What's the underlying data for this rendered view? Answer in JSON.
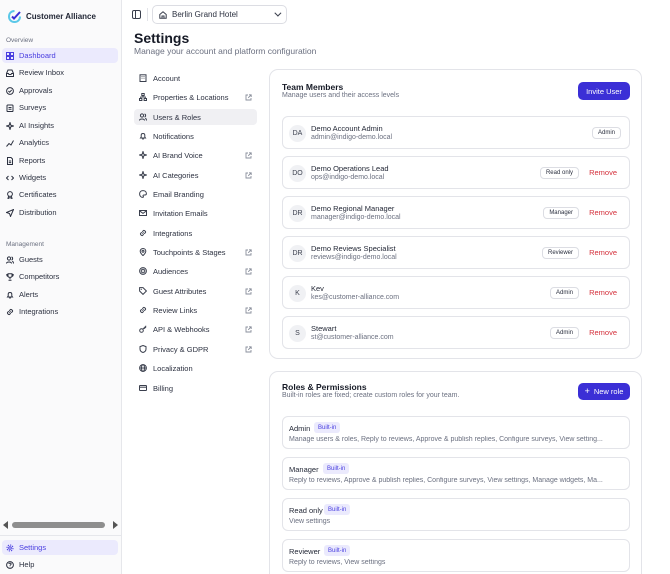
{
  "brand": {
    "name": "Customer Alliance"
  },
  "sidebar": {
    "overview_label": "Overview",
    "management_label": "Management",
    "overview_items": [
      {
        "label": "Dashboard",
        "icon": "grid-icon",
        "active": true
      },
      {
        "label": "Review Inbox",
        "icon": "inbox-icon"
      },
      {
        "label": "Approvals",
        "icon": "check-circle-icon"
      },
      {
        "label": "Surveys",
        "icon": "clipboard-icon"
      },
      {
        "label": "AI Insights",
        "icon": "sparkle-icon"
      },
      {
        "label": "Analytics",
        "icon": "chart-icon"
      },
      {
        "label": "Reports",
        "icon": "document-icon"
      },
      {
        "label": "Widgets",
        "icon": "code-icon"
      },
      {
        "label": "Certificates",
        "icon": "award-icon"
      },
      {
        "label": "Distribution",
        "icon": "send-icon"
      }
    ],
    "management_items": [
      {
        "label": "Guests",
        "icon": "users-icon"
      },
      {
        "label": "Competitors",
        "icon": "trophy-icon"
      },
      {
        "label": "Alerts",
        "icon": "bell-icon"
      },
      {
        "label": "Integrations",
        "icon": "link-icon"
      }
    ],
    "footer_items": [
      {
        "label": "Settings",
        "icon": "gear-icon",
        "active": true
      },
      {
        "label": "Help",
        "icon": "help-icon"
      }
    ]
  },
  "topbar": {
    "hotel": "Berlin Grand Hotel"
  },
  "page": {
    "title": "Settings",
    "subtitle": "Manage your account and platform configuration"
  },
  "settings_nav": [
    {
      "label": "Account",
      "icon": "building-icon",
      "external": false
    },
    {
      "label": "Properties & Locations",
      "icon": "sitemap-icon",
      "external": true
    },
    {
      "label": "Users & Roles",
      "icon": "users-icon",
      "external": false,
      "active": true
    },
    {
      "label": "Notifications",
      "icon": "bell-icon",
      "external": false
    },
    {
      "label": "AI Brand Voice",
      "icon": "sparkle-icon",
      "external": true
    },
    {
      "label": "AI Categories",
      "icon": "sparkle-icon",
      "external": true
    },
    {
      "label": "Email Branding",
      "icon": "palette-icon",
      "external": false
    },
    {
      "label": "Invitation Emails",
      "icon": "mail-icon",
      "external": false
    },
    {
      "label": "Integrations",
      "icon": "link-icon",
      "external": false
    },
    {
      "label": "Touchpoints & Stages",
      "icon": "pin-icon",
      "external": true
    },
    {
      "label": "Audiences",
      "icon": "target-icon",
      "external": true
    },
    {
      "label": "Guest Attributes",
      "icon": "tag-icon",
      "external": true
    },
    {
      "label": "Review Links",
      "icon": "link-icon",
      "external": true
    },
    {
      "label": "API & Webhooks",
      "icon": "key-icon",
      "external": true
    },
    {
      "label": "Privacy & GDPR",
      "icon": "shield-icon",
      "external": true
    },
    {
      "label": "Localization",
      "icon": "globe-icon",
      "external": false
    },
    {
      "label": "Billing",
      "icon": "card-icon",
      "external": false
    }
  ],
  "team": {
    "title": "Team Members",
    "description": "Manage users and their access levels",
    "invite_label": "Invite User",
    "remove_label": "Remove",
    "members": [
      {
        "initials": "DA",
        "name": "Demo Account Admin",
        "email": "admin@indigo-demo.local",
        "role": "Admin",
        "removable": false
      },
      {
        "initials": "DO",
        "name": "Demo Operations Lead",
        "email": "ops@indigo-demo.local",
        "role": "Read only",
        "removable": true
      },
      {
        "initials": "DR",
        "name": "Demo Regional Manager",
        "email": "manager@indigo-demo.local",
        "role": "Manager",
        "removable": true
      },
      {
        "initials": "DR",
        "name": "Demo Reviews Specialist",
        "email": "reviews@indigo-demo.local",
        "role": "Reviewer",
        "removable": true
      },
      {
        "initials": "K",
        "name": "Kev",
        "email": "kes@customer-alliance.com",
        "role": "Admin",
        "removable": true
      },
      {
        "initials": "S",
        "name": "Stewart",
        "email": "st@customer-alliance.com",
        "role": "Admin",
        "removable": true
      }
    ]
  },
  "roles": {
    "title": "Roles & Permissions",
    "description": "Built-in roles are fixed; create custom roles for your team.",
    "new_role_label": "New role",
    "builtin_label": "Built-in",
    "items": [
      {
        "name": "Admin",
        "permissions": "Manage users & roles, Reply to reviews, Approve & publish replies, Configure surveys, View setting..."
      },
      {
        "name": "Manager",
        "permissions": "Reply to reviews, Approve & publish replies, Configure surveys, View settings, Manage widgets, Ma..."
      },
      {
        "name": "Read only",
        "permissions": "View settings"
      },
      {
        "name": "Reviewer",
        "permissions": "Reply to reviews, View settings"
      }
    ]
  },
  "colors": {
    "accent": "#3b2fd6",
    "danger": "#d42f3a",
    "active_bg": "#ebeafd"
  }
}
